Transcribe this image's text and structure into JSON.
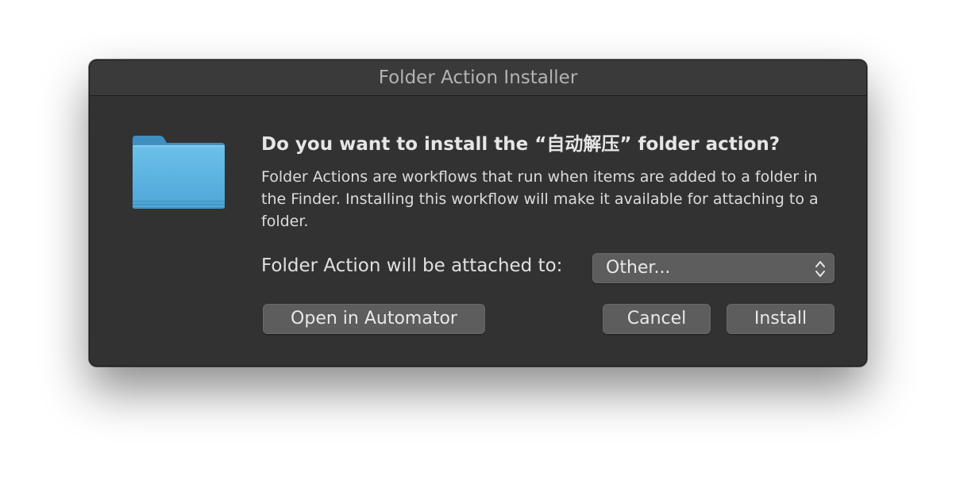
{
  "window": {
    "title": "Folder Action Installer"
  },
  "dialog": {
    "icon": "folder-icon",
    "heading": "Do you want to install the “自动解压” folder action?",
    "body": "Folder Actions are workflows that run when items are added to a folder in the Finder. Installing this workflow will make it available for attaching to a folder.",
    "attach_label": "Folder Action will be attached to:",
    "attach_value": "Other...",
    "buttons": {
      "open_automator": "Open in Automator",
      "cancel": "Cancel",
      "install": "Install"
    }
  },
  "colors": {
    "window_bg": "#323232",
    "titlebar_bg": "#3a3a3a",
    "button_bg": "#5d5d5d",
    "folder_blue": "#5fb4e2"
  }
}
